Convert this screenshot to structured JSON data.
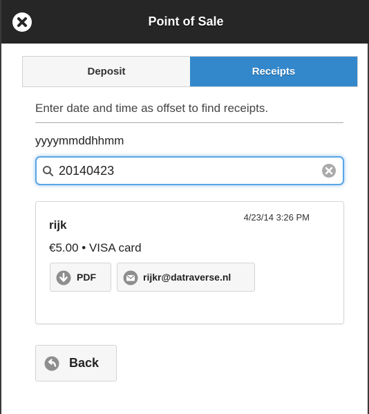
{
  "header": {
    "title": "Point of Sale",
    "close_icon": "close-icon"
  },
  "tabs": [
    {
      "label": "Deposit",
      "active": false
    },
    {
      "label": "Receipts",
      "active": true
    }
  ],
  "accent_color": "#3388cc",
  "hint": "Enter date and time as offset to find receipts.",
  "format_label": "yyyymmddhhmm",
  "search": {
    "value": "20140423",
    "icon": "search-icon",
    "clear_icon": "clear-icon"
  },
  "receipt": {
    "name": "rijk",
    "date": "4/23/14 3:26 PM",
    "amount": "€5.00 • VISA card",
    "pdf_label": "PDF",
    "pdf_icon": "download-icon",
    "email_label": "rijkr@datraverse.nl",
    "email_icon": "mail-icon"
  },
  "back": {
    "label": "Back",
    "icon": "back-arrow-icon"
  }
}
